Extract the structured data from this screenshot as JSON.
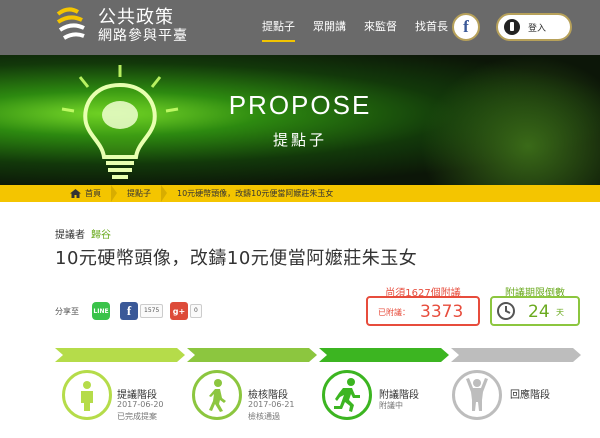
{
  "header": {
    "logo_title": "公共政策",
    "logo_subtitle": "網路參與平臺",
    "nav": [
      {
        "label": "提點子",
        "active": true
      },
      {
        "label": "眾開講",
        "active": false
      },
      {
        "label": "來監督",
        "active": false
      },
      {
        "label": "找首長",
        "active": false
      }
    ],
    "facebook_icon": "facebook-icon",
    "login_label": "登入"
  },
  "banner": {
    "title": "PROPOSE",
    "subtitle": "提點子"
  },
  "breadcrumb": {
    "home": "首頁",
    "section": "提點子",
    "current": "10元硬幣頭像，改鑄10元便當阿嬤莊朱玉女"
  },
  "proposal": {
    "proposer_label": "提議者",
    "proposer_name": "歸谷",
    "title": "10元硬幣頭像，改鑄10元便當阿嬤莊朱玉女"
  },
  "share": {
    "label": "分享至",
    "line_text": "LINE",
    "facebook_count": "1575",
    "gplus_text": "g+",
    "gplus_count": "0"
  },
  "votes": {
    "needed_label": "尚須1627個附議",
    "prefix": "已附議：",
    "count": "3373"
  },
  "countdown": {
    "label": "附議期限倒數",
    "days": "24",
    "unit": "天"
  },
  "stages": [
    {
      "name": "提議階段",
      "date": "2017-06-20",
      "status": "已完成提案",
      "icon": "person-standing-icon"
    },
    {
      "name": "檢核階段",
      "date": "2017-06-21",
      "status": "檢核通過",
      "icon": "person-walking-icon"
    },
    {
      "name": "附議階段",
      "date": "",
      "status": "附議中",
      "icon": "person-running-icon"
    },
    {
      "name": "回應階段",
      "date": "",
      "status": "",
      "icon": "person-raising-arms-icon"
    }
  ],
  "colors": {
    "brand_yellow": "#f4c500",
    "accent_green": "#8cc63f",
    "alert_red": "#e74c3c",
    "header_gray": "#6a6a6a",
    "inactive_gray": "#bdbdbd"
  }
}
